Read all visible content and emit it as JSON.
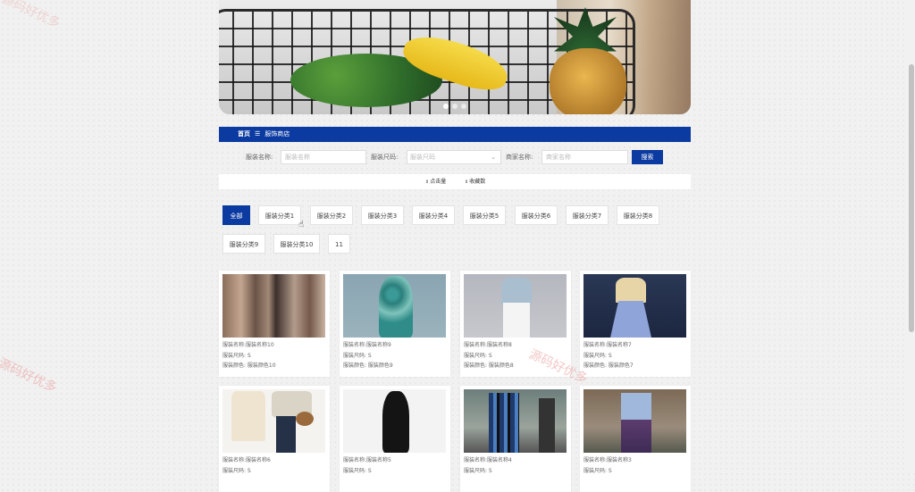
{
  "breadcrumb": {
    "home": "首页",
    "separator": "☰",
    "current": "服饰商店"
  },
  "search": {
    "name_label": "服装名称:",
    "name_placeholder": "服装名称",
    "size_label": "服装尺码:",
    "size_placeholder": "服装尺码",
    "merchant_label": "商家名称:",
    "merchant_placeholder": "商家名称",
    "button": "搜索"
  },
  "sort": {
    "clicks": "点击量",
    "favorites": "收藏数",
    "arrow": "⇕"
  },
  "categories": [
    "全部",
    "服装分类1",
    "服装分类2",
    "服装分类3",
    "服装分类4",
    "服装分类5",
    "服装分类6",
    "服装分类7",
    "服装分类8",
    "服装分类9",
    "服装分类10",
    "11"
  ],
  "products": [
    {
      "name": "服装名称:服装名称10",
      "size": "服装尺码: S",
      "color": "服装颜色: 服装颜色10"
    },
    {
      "name": "服装名称:服装名称9",
      "size": "服装尺码: S",
      "color": "服装颜色: 服装颜色9"
    },
    {
      "name": "服装名称:服装名称8",
      "size": "服装尺码: S",
      "color": "服装颜色: 服装颜色8"
    },
    {
      "name": "服装名称:服装名称7",
      "size": "服装尺码: S",
      "color": "服装颜色: 服装颜色7"
    },
    {
      "name": "服装名称:服装名称6",
      "size": "服装尺码: S",
      "color": ""
    },
    {
      "name": "服装名称:服装名称5",
      "size": "服装尺码: S",
      "color": ""
    },
    {
      "name": "服装名称:服装名称4",
      "size": "服装尺码: S",
      "color": ""
    },
    {
      "name": "服装名称:服装名称3",
      "size": "服装尺码: S",
      "color": ""
    }
  ],
  "watermark": "源码好优多",
  "colors": {
    "primary": "#0b3aa0",
    "background": "#f1f1f1"
  }
}
